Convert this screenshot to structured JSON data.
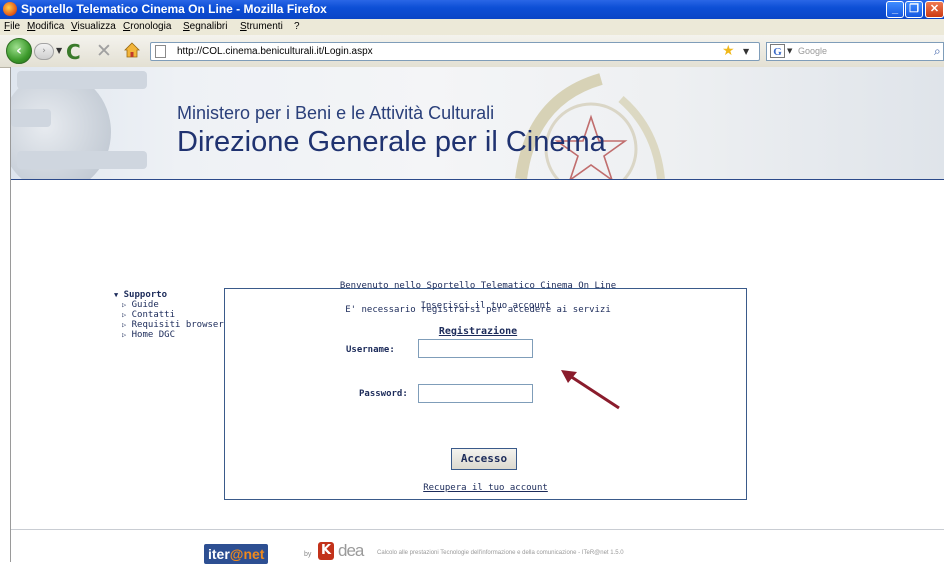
{
  "window": {
    "title": "Sportello Telematico Cinema On Line - Mozilla Firefox"
  },
  "menu": [
    "File",
    "Modifica",
    "Visualizza",
    "Cronologia",
    "Segnalibri",
    "Strumenti",
    "?"
  ],
  "nav": {
    "url": "http://COL.cinema.beniculturali.it/Login.aspx",
    "search_placeholder": "Google"
  },
  "banner": {
    "line1": "Ministero per i Beni e le Attività Culturali",
    "line2": "Direzione Generale per il Cinema"
  },
  "intro": {
    "welcome": "Benvenuto nello Sportello Telematico Cinema On Line",
    "register_note": "E' necessario registrarsi per accedere ai servizi",
    "register_link": "Registrazione"
  },
  "sidebar": {
    "heading": "Supporto",
    "items": [
      "Guide",
      "Contatti",
      "Requisiti browser",
      "Home DGC"
    ]
  },
  "login": {
    "title": "Inserisci il tuo account",
    "username_label": "Username:",
    "username_value": "",
    "password_label": "Password:",
    "password_value": "",
    "submit": "Accesso",
    "recover": "Recupera il tuo account"
  },
  "footer": {
    "logo_iter": "iter",
    "logo_net": "@net",
    "by": "by",
    "logo_dea": "dea",
    "note": "Calcolo alle prestazioni Tecnologie dell'informazione e della comunicazione - ITeR@net 1.5.0"
  },
  "colors": {
    "title_bar": "#0a45c6",
    "text_navy": "#1c2b5a",
    "banner_text": "#1f3270",
    "arrow": "#8a1c2c"
  }
}
